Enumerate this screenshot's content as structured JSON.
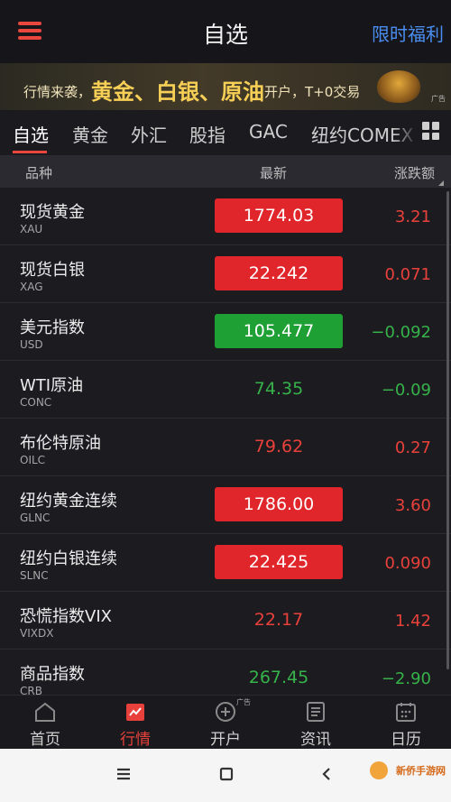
{
  "header": {
    "title": "自选",
    "promo_label": "限时福利"
  },
  "banner": {
    "prefix": "行情来袭，",
    "highlight": "黄金、白银、原油",
    "suffix": "开户，T+0交易",
    "ad_tag": "广告"
  },
  "tabs": [
    {
      "label": "自选"
    },
    {
      "label": "黄金"
    },
    {
      "label": "外汇"
    },
    {
      "label": "股指"
    },
    {
      "label": "GAC"
    },
    {
      "label": "纽约COMEX"
    }
  ],
  "columns": {
    "name": "品种",
    "latest": "最新",
    "change": "涨跌额"
  },
  "quotes": [
    {
      "name": "现货黄金",
      "code": "XAU",
      "price": "1774.03",
      "change": "3.21"
    },
    {
      "name": "现货白银",
      "code": "XAG",
      "price": "22.242",
      "change": "0.071"
    },
    {
      "name": "美元指数",
      "code": "USD",
      "price": "105.477",
      "change": "−0.092"
    },
    {
      "name": "WTI原油",
      "code": "CONC",
      "price": "74.35",
      "change": "−0.09"
    },
    {
      "name": "布伦特原油",
      "code": "OILC",
      "price": "79.62",
      "change": "0.27"
    },
    {
      "name": "纽约黄金连续",
      "code": "GLNC",
      "price": "1786.00",
      "change": "3.60"
    },
    {
      "name": "纽约白银连续",
      "code": "SLNC",
      "price": "22.425",
      "change": "0.090"
    },
    {
      "name": "恐慌指数VIX",
      "code": "VIXDX",
      "price": "22.17",
      "change": "1.42"
    },
    {
      "name": "商品指数",
      "code": "CRB",
      "price": "267.45",
      "change": "−2.90"
    }
  ],
  "nav": [
    {
      "label": "首页",
      "icon": "home-icon"
    },
    {
      "label": "行情",
      "icon": "chart-icon"
    },
    {
      "label": "开户",
      "icon": "plus-circle-icon",
      "ad": "广告"
    },
    {
      "label": "资讯",
      "icon": "news-icon"
    },
    {
      "label": "日历",
      "icon": "calendar-icon"
    }
  ],
  "watermark": "新侨手游网",
  "colors": {
    "up": "#e0262a",
    "down": "#1fa035",
    "accent": "#e9463e",
    "link": "#4a8df0"
  }
}
